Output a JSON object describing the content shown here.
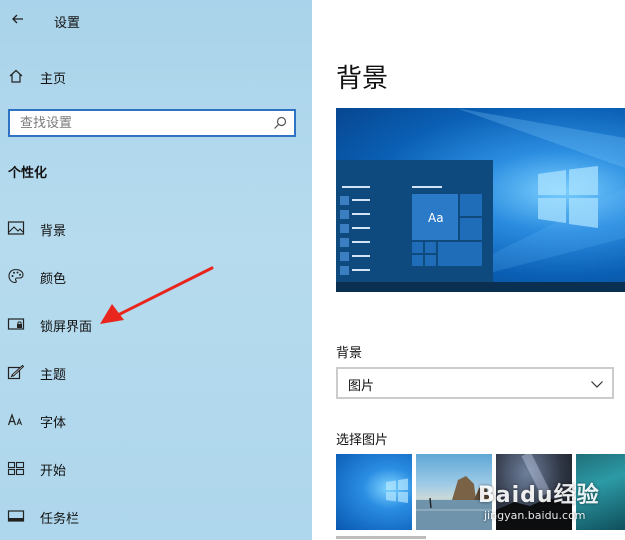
{
  "window": {
    "title": "设置"
  },
  "sidebar": {
    "home_label": "主页",
    "search": {
      "placeholder": "查找设置",
      "value": ""
    },
    "section_heading": "个性化",
    "items": [
      {
        "label": "背景",
        "icon": "image-icon"
      },
      {
        "label": "颜色",
        "icon": "palette-icon"
      },
      {
        "label": "锁屏界面",
        "icon": "lock-screen-icon"
      },
      {
        "label": "主题",
        "icon": "theme-icon"
      },
      {
        "label": "字体",
        "icon": "font-icon"
      },
      {
        "label": "开始",
        "icon": "start-icon"
      },
      {
        "label": "任务栏",
        "icon": "taskbar-icon"
      }
    ]
  },
  "main": {
    "title": "背景",
    "preview": {
      "tile_text": "Aa"
    },
    "background_label": "背景",
    "background_dropdown": {
      "selected": "图片"
    },
    "choose_picture_label": "选择图片"
  },
  "watermark": {
    "brand": "Baidu经验",
    "url": "jingyan.baidu.com"
  },
  "colors": {
    "accent": "#1c6fc7",
    "sidebar_bg": "#b1d8ed",
    "annotation_arrow": "#e8261e"
  }
}
